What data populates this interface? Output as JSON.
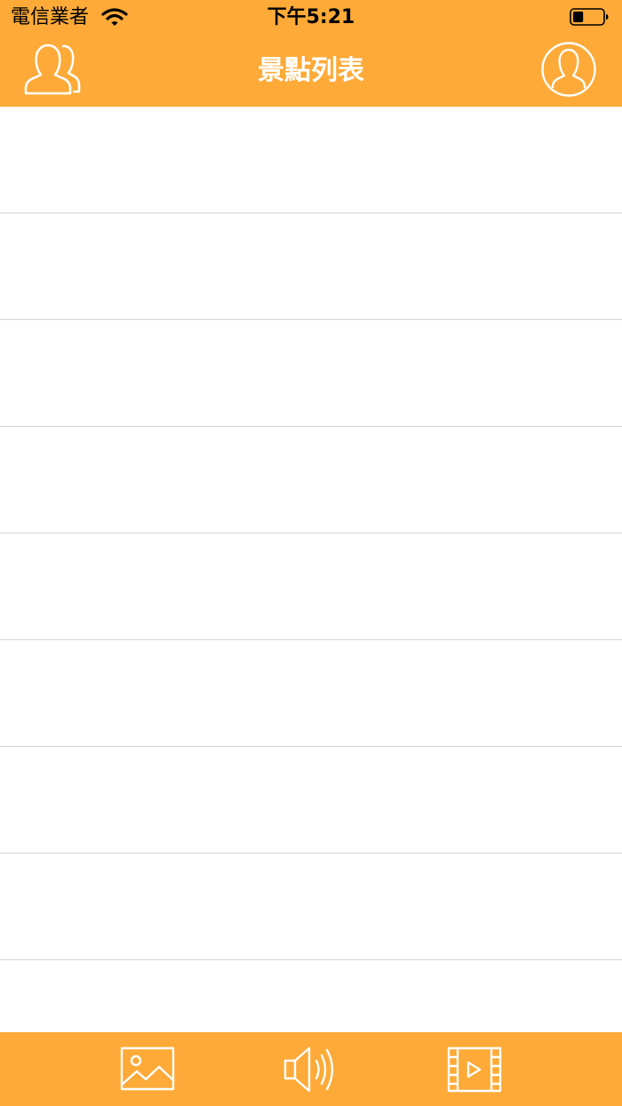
{
  "status_bar": {
    "carrier": "電信業者",
    "time": "下午5:21",
    "battery_level": 0.35
  },
  "nav_bar": {
    "title": "景點列表",
    "left_icon": "users-icon",
    "right_icon": "user-profile-icon"
  },
  "list": {
    "rows": [
      "",
      "",
      "",
      "",
      "",
      "",
      "",
      "",
      ""
    ]
  },
  "tab_bar": {
    "items": [
      {
        "icon": "image-icon"
      },
      {
        "icon": "speaker-icon"
      },
      {
        "icon": "video-icon"
      }
    ]
  },
  "colors": {
    "accent": "#FDAA38",
    "separator": "#D4D4D4",
    "background": "#FFFFFF"
  }
}
